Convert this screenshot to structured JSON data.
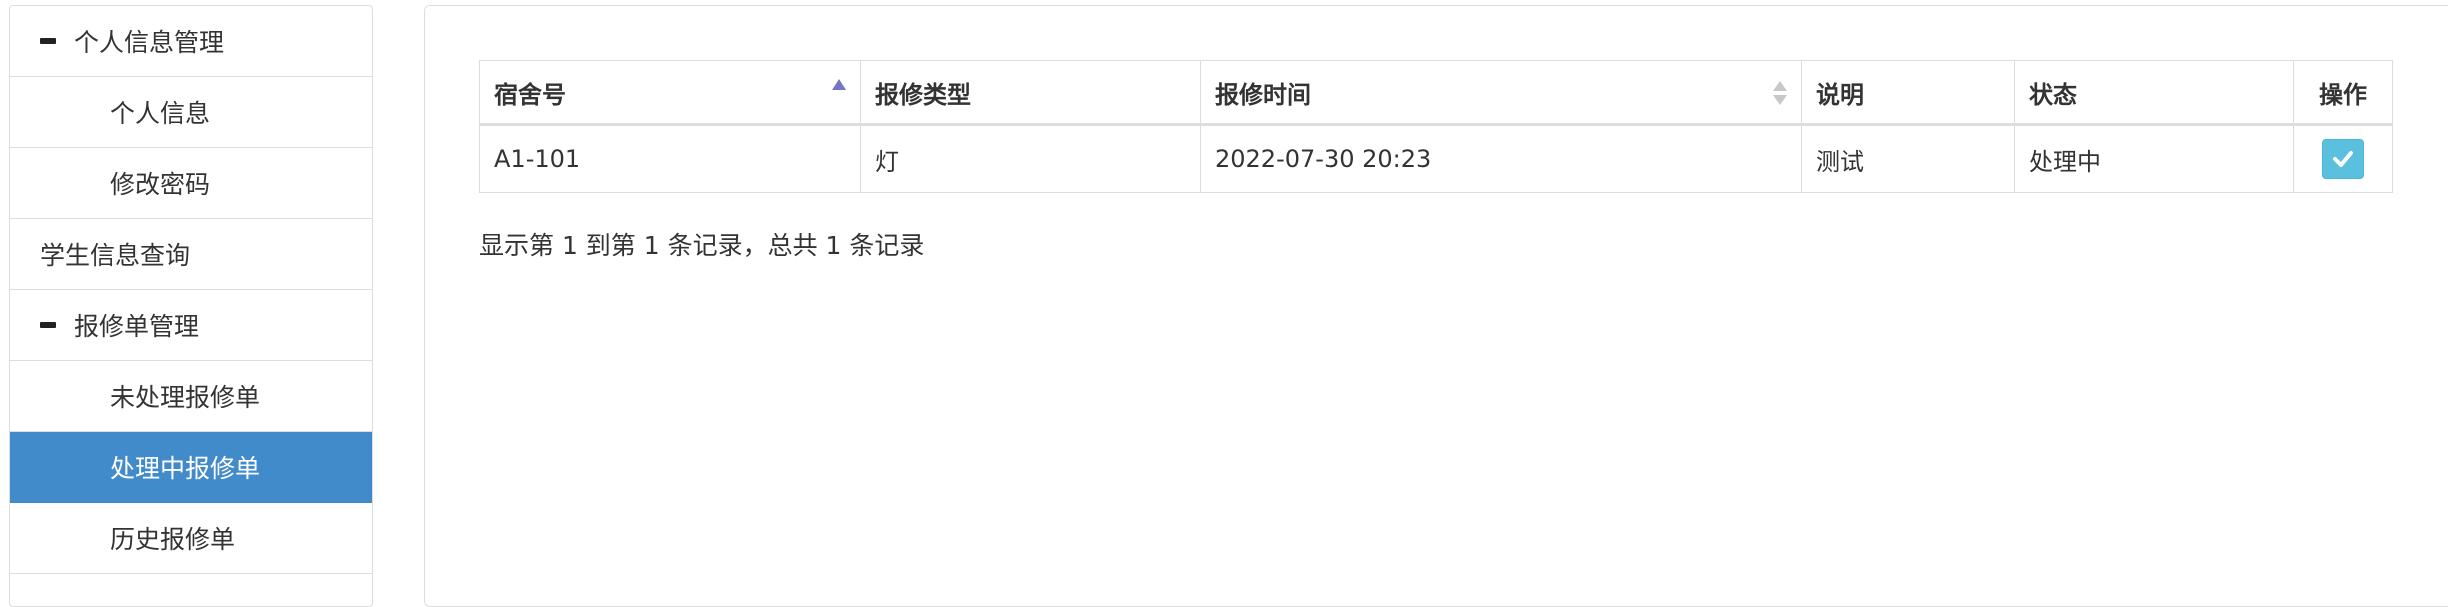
{
  "sidebar": {
    "items": [
      {
        "label": "个人信息管理",
        "icon": "minus-icon"
      },
      {
        "label": "个人信息"
      },
      {
        "label": "修改密码"
      },
      {
        "label": "学生信息查询"
      },
      {
        "label": "报修单管理",
        "icon": "minus-icon"
      },
      {
        "label": "未处理报修单"
      },
      {
        "label": "处理中报修单",
        "active": true
      },
      {
        "label": "历史报修单"
      }
    ],
    "active_color": "#428bca"
  },
  "table": {
    "headers": [
      "宿舍号",
      "报修类型",
      "报修时间",
      "说明",
      "状态",
      "操作"
    ],
    "sort": {
      "宿舍号": "ascending",
      "报修时间": "sortable"
    },
    "rows": [
      {
        "dorm": "A1-101",
        "type": "灯",
        "time": "2022-07-30 20:23",
        "note": "测试",
        "status": "处理中",
        "action": "check-icon"
      }
    ],
    "action_color": "#5bc0de"
  },
  "pagination": {
    "info": "显示第 1 到第 1 条记录，总共 1 条记录"
  }
}
